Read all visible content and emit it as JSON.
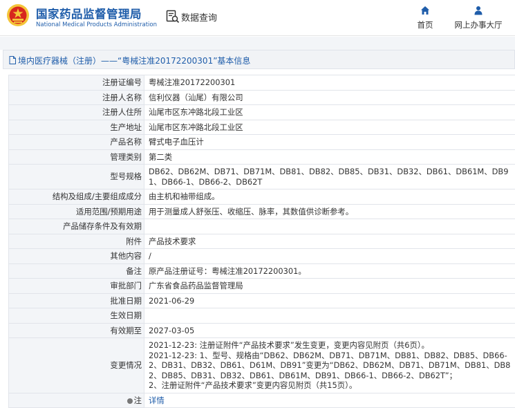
{
  "header": {
    "brand_cn": "国家药品监督管理局",
    "brand_en": "National Medical Products Administration",
    "search_label": "数据查询",
    "nav": [
      {
        "label": "首页",
        "icon": "home-icon"
      },
      {
        "label": "网上办事大厅",
        "icon": "user-icon"
      }
    ]
  },
  "page": {
    "title": "境内医疗器械（注册）——“粤械注准20172200301”基本信息"
  },
  "colors": {
    "brand": "#1f5daa",
    "key_bg": "#f3f5f8",
    "border": "#e1e4ea"
  },
  "record": [
    {
      "key": "注册证编号",
      "value": [
        "粤械注准20172200301"
      ]
    },
    {
      "key": "注册人名称",
      "value": [
        "信利仪器（汕尾）有限公司"
      ]
    },
    {
      "key": "注册人住所",
      "value": [
        "汕尾市区东冲路北段工业区"
      ]
    },
    {
      "key": "生产地址",
      "value": [
        "汕尾市区东冲路北段工业区"
      ]
    },
    {
      "key": "产品名称",
      "value": [
        "臂式电子血压计"
      ]
    },
    {
      "key": "管理类别",
      "value": [
        "第二类"
      ]
    },
    {
      "key": "型号规格",
      "value": [
        "DB62、DB62M、DB71、DB71M、DB81、DB82、DB85、DB31、DB32、DB61、DB61M、DB91、DB66-1、DB66-2、DB62T"
      ]
    },
    {
      "key": "结构及组成/主要组成成分",
      "value": [
        "由主机和袖带组成。"
      ]
    },
    {
      "key": "适用范围/预期用途",
      "value": [
        "用于测量成人舒张压、收缩压、脉率，其数值供诊断参考。"
      ]
    },
    {
      "key": "产品储存条件及有效期",
      "value": [
        ""
      ]
    },
    {
      "key": "附件",
      "value": [
        "产品技术要求"
      ]
    },
    {
      "key": "其他内容",
      "value": [
        "/"
      ]
    },
    {
      "key": "备注",
      "value": [
        "原产品注册证号：粤械注准20172200301。"
      ]
    },
    {
      "key": "审批部门",
      "value": [
        "广东省食品药品监督管理局"
      ]
    },
    {
      "key": "批准日期",
      "value": [
        "2021-06-29"
      ]
    },
    {
      "key": "生效日期",
      "value": [
        ""
      ]
    },
    {
      "key": "有效期至",
      "value": [
        "2027-03-05"
      ]
    },
    {
      "key": "变更情况",
      "value": [
        "2021-12-23: 注册证附件“产品技术要求”发生变更，变更内容见附页（共6页）。",
        "2021-12-23: 1、型号、规格由“DB62、DB62M、DB71、DB71M、DB81、DB82、DB85、DB66-2、DB31、DB32、DB61、D61M、DB91”变更为“DB62、DB62M、DB71、DB71M、DB81、DB82、DB85、DB31、DB32、DB61、DB61M、DB91、DB66-1、DB66-2、DB62T”；",
        "2、注册证附件“产品技术要求”变更内容见附页（共15页）。"
      ]
    }
  ],
  "note": {
    "key": "注",
    "link": "详情"
  }
}
